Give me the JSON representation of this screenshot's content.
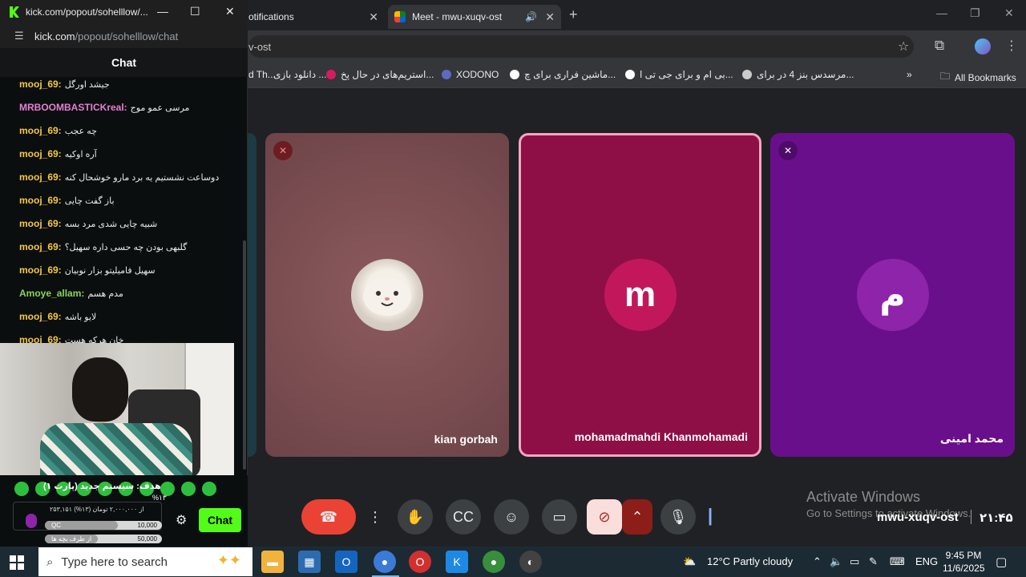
{
  "chrome": {
    "tabs": [
      {
        "title": "otifications"
      },
      {
        "title": "Meet - mwu-xuqv-ost"
      }
    ],
    "omnibox": "v-ost",
    "bookmarks": [
      "d Th...",
      "دانلود بازی ...",
      "استریم‌های در حال پخ...",
      "XODONO",
      "ماشین فراری  برای چ...",
      "بی ام و برای جی تی ا...",
      "مرسدس بنز 4 در برای...",
      "All Bookmarks"
    ]
  },
  "meet": {
    "participants": [
      {
        "name": "kian gorbah",
        "initial": "",
        "muted": true
      },
      {
        "name": "mohamadmahdi Khanmohamadi",
        "initial": "m",
        "muted": false
      },
      {
        "name": "محمد امینی",
        "initial": "م",
        "muted": true
      }
    ],
    "meeting_code": "mwu-xuqv-ost",
    "time": "۲۱:۴۵",
    "activate_title": "Activate Windows",
    "activate_sub": "Go to Settings to activate Windows."
  },
  "popout": {
    "window_title": "kick.com/popout/sohelllow/...",
    "url_domain": "kick.com",
    "url_path": "/popout/sohelllow/chat",
    "chat_header": "Chat",
    "messages": [
      {
        "user": "mooj_69:",
        "text": "جیشد اورگل",
        "color": "#f6c744"
      },
      {
        "user": "MRBOOMBASTICKreal:",
        "text": "مرسی عمو موج",
        "color": "#e67fd3"
      },
      {
        "user": "mooj_69:",
        "text": "چه عجب",
        "color": "#f6c744"
      },
      {
        "user": "mooj_69:",
        "text": "آره اوکیه",
        "color": "#f6c744"
      },
      {
        "user": "mooj_69:",
        "text": "دوساعت نشستیم یه برد مارو خوشحال کنه",
        "color": "#f6c744"
      },
      {
        "user": "mooj_69:",
        "text": "باز گفت چایی",
        "color": "#f6c744"
      },
      {
        "user": "mooj_69:",
        "text": "شبیه چایی شدی مرد بسه",
        "color": "#f6c744"
      },
      {
        "user": "mooj_69:",
        "text": "گلبهی بودن چه حسی داره سهیل؟",
        "color": "#f6c744"
      },
      {
        "user": "mooj_69:",
        "text": "سهیل فامیلیتو بزار نوبیان",
        "color": "#f6c744"
      },
      {
        "user": "Amoye_allam:",
        "text": "مدم هسم",
        "color": "#8bd35c"
      },
      {
        "user": "mooj_69:",
        "text": "لایو باشه",
        "color": "#f6c744"
      },
      {
        "user": "mooj_69:",
        "text": "خان هرکه هست",
        "color": "#f6c744"
      }
    ],
    "goal_text": "هدف: سیستم جدید (پارت ۱)",
    "goal_percent": "%۱۳",
    "goal_progress": "۲۵۳,۱۵۱ از ۲,۰۰۰,۰۰۰ تومان (۱۳%)",
    "bars": [
      {
        "label": "QC",
        "value": "10,000",
        "fill": 0.62
      },
      {
        "label": "از طرف بچه ها",
        "value": "50,000",
        "fill": 0.45
      }
    ],
    "chat_button": "Chat"
  },
  "taskbar": {
    "search_placeholder": "Type here to search",
    "weather": "12°C  Partly cloudy",
    "lang": "ENG",
    "time": "9:45 PM",
    "date": "11/6/2025"
  }
}
